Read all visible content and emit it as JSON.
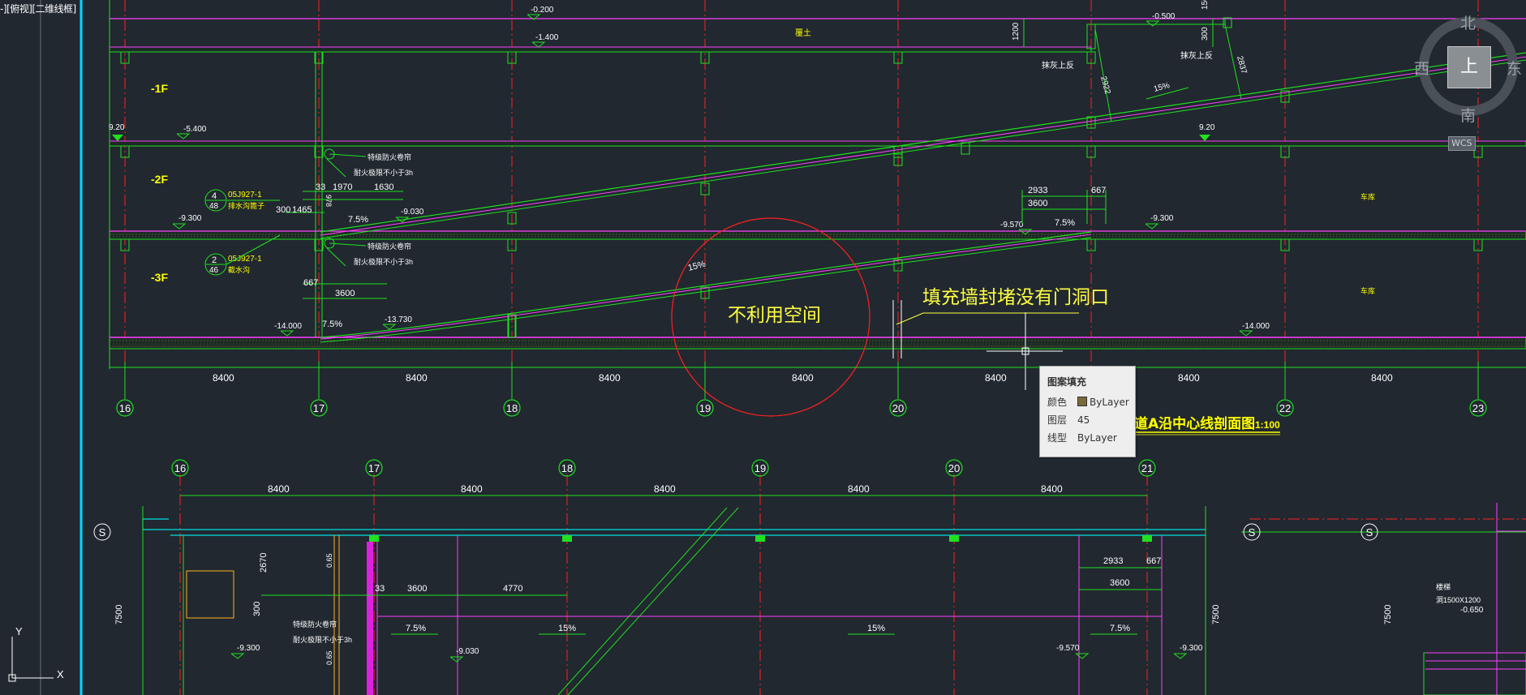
{
  "viewport_label": "-][俯视][二维线框]",
  "compass": {
    "north": "北",
    "south": "南",
    "east": "东",
    "west": "西",
    "center": "上",
    "wcs": "WCS"
  },
  "tooltip": {
    "title": "图案填充",
    "rows": [
      {
        "key": "颜色",
        "value": "ByLayer"
      },
      {
        "key": "图层",
        "value": "45"
      },
      {
        "key": "线型",
        "value": "ByLayer"
      }
    ]
  },
  "upper": {
    "floors": [
      "-1F",
      "-2F",
      "-3F"
    ],
    "grid_labels": [
      "16",
      "17",
      "18",
      "19",
      "20",
      "21",
      "22",
      "23"
    ],
    "spans": [
      "8400",
      "8400",
      "8400",
      "8400",
      "8400",
      "8400",
      "8400"
    ],
    "elevations": {
      "top_a": "-0.200",
      "top_b": "-1.400",
      "top_c": "-0.500",
      "f2_left": "-5.400",
      "f3_left": "-9.300",
      "f3_mid": "-9.030",
      "f3_right_a": "-9.570",
      "f3_right_b": "-9.300",
      "base_a": "-14.000",
      "base_b": "-13.730",
      "base_c": "-14.000"
    },
    "dims": {
      "h1200": "1200",
      "h300": "300",
      "h150": "150",
      "d2922": "2922",
      "d2837": "2837",
      "d33": "33",
      "d1970": "1970",
      "d1630": "1630",
      "d978": "978",
      "d300": "300",
      "d1465": "1465",
      "d2933": "2933",
      "d667": "667",
      "d3600": "3600",
      "b667": "667",
      "b3600": "3600"
    },
    "slopes": {
      "s1": "15%",
      "s2": "7.5%",
      "s3": "15%",
      "s4": "7.5%",
      "s5": "7.5%"
    },
    "level_920": "9.20",
    "soil": "覆土",
    "refs": [
      {
        "num": "4",
        "den": "48",
        "code": "05J927-1",
        "desc": "排水沟篦子"
      },
      {
        "num": "2",
        "den": "46",
        "code": "05J927-1",
        "desc": "截水沟"
      }
    ],
    "notes": {
      "door_top": "特级防火卷帘",
      "door_bottom": "耐火极限不小于3h",
      "door_top2": "特级防火卷帘",
      "door_bottom2": "耐火极限不小于3h",
      "plaster1": "抹灰上反",
      "plaster2": "抹灰上反",
      "room1": "车库",
      "room2": "车库"
    },
    "annotation_unused": "不利用空间",
    "annotation_wall": "填充墙封堵没有门洞口",
    "section_title": "道A沿中心线剖面图",
    "section_scale": "1:100"
  },
  "lower": {
    "grid_labels": [
      "16",
      "17",
      "18",
      "19",
      "20",
      "21"
    ],
    "spans": [
      "8400",
      "8400",
      "8400",
      "8400",
      "8400"
    ],
    "section_marks": [
      "S",
      "S",
      "S"
    ],
    "dims": {
      "d2670": "2670",
      "d300": "300",
      "d33": "33",
      "d3600": "3600",
      "d4770": "4770",
      "d2933": "2933",
      "d667": "667",
      "d3600b": "3600",
      "d7500a": "7500",
      "d7500b": "7500",
      "d7500c": "7500",
      "v065a": "0.65",
      "v065b": "0.65"
    },
    "slopes": [
      "7.5%",
      "15%",
      "15%",
      "7.5%"
    ],
    "elevations": {
      "a": "-9.300",
      "b": "-9.030",
      "c": "-9.570",
      "d": "-9.300",
      "e": "-0.650"
    },
    "notes": {
      "door_top": "特级防火卷帘",
      "door_bottom": "耐火极限不小于3h",
      "stair": "楼梯",
      "hole": "洞1500X1200"
    }
  },
  "ucs": {
    "y": "Y",
    "x": "X"
  }
}
